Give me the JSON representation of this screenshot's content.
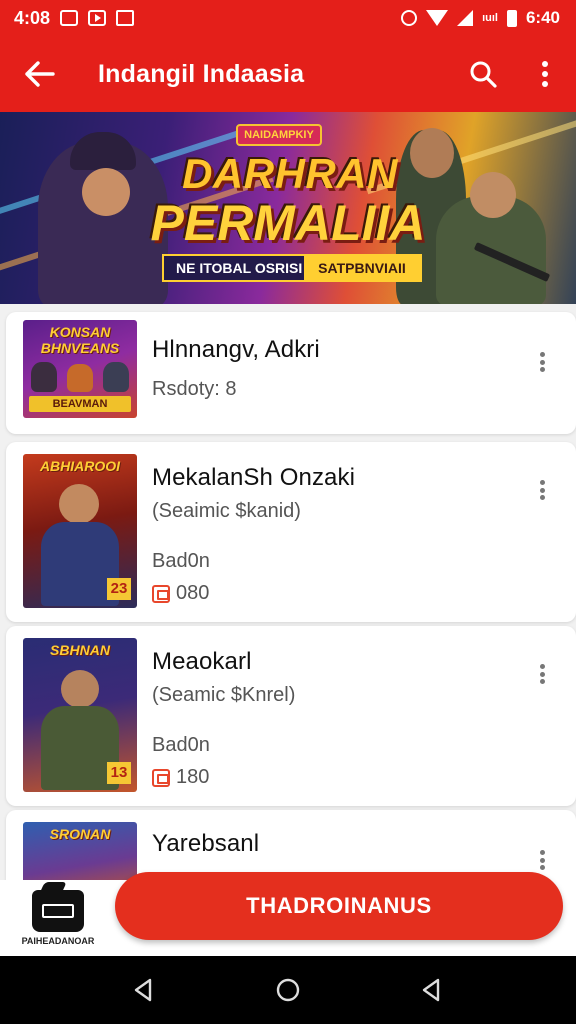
{
  "status_bar": {
    "time_left": "4:08",
    "time_right": "6:40",
    "small_label": "ıuıl"
  },
  "app_bar": {
    "title": "Indangil Indaasia"
  },
  "banner": {
    "tag": "NAIDAMPKIY",
    "title_line1": "DARHRAN",
    "title_line2": "PERMALIIA",
    "strip_left": "NE ITOBAL OSRISI",
    "strip_right": "SATPBNVIAII"
  },
  "items": [
    {
      "title": "Hlnnangv, Adkri",
      "subtitle": "Rsdoty: 8",
      "thumb_head": "KONSAN BHNVEANS",
      "thumb_label": "BEAVMAN"
    },
    {
      "title": "MekalanSh Onzaki",
      "subtitle": "(Seaimic $kanid)",
      "status": "Bad0n",
      "count": "080",
      "thumb_head": "ABHIAROOI",
      "thumb_badge": "23"
    },
    {
      "title": "Meaokarl",
      "subtitle": "(Seamic $Knrel)",
      "status": "Bad0n",
      "count": "180",
      "thumb_head": "SBHNAN",
      "thumb_badge": "13"
    },
    {
      "title": "Yarebsanl",
      "thumb_head": "SRONAN"
    }
  ],
  "bottom_bar": {
    "shop_label": "PAIHEADANOAR",
    "cta_label": "THADROINANUS"
  },
  "colors": {
    "primary": "#e41f1a",
    "cta": "#e42f1e",
    "accent_gold": "#ffc32e"
  }
}
